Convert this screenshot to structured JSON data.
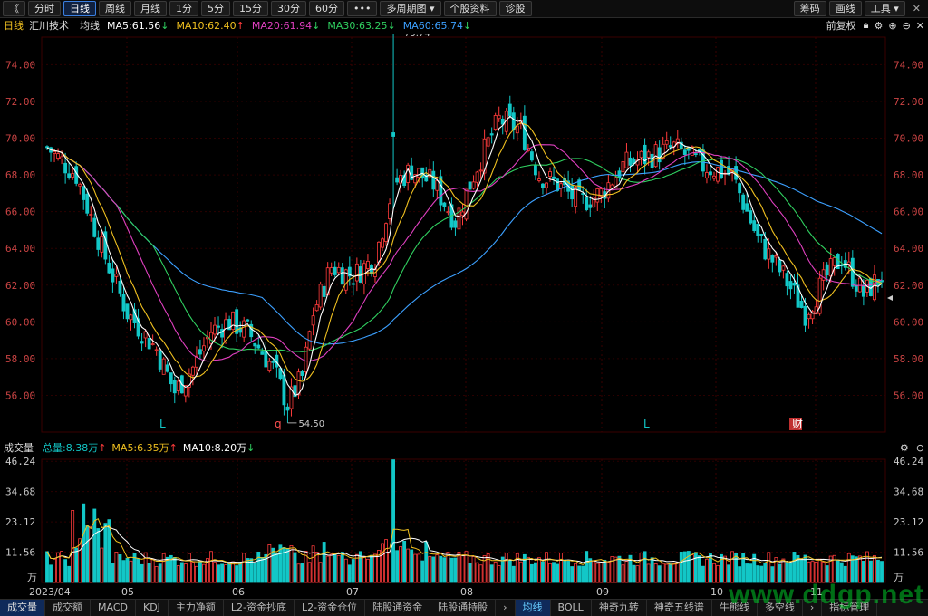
{
  "toolbar": {
    "back": "《",
    "buttons": [
      "分时",
      "日线",
      "周线",
      "月线",
      "1分",
      "5分",
      "15分",
      "30分",
      "60分",
      "•••",
      "多周期图 ▾",
      "个股资料",
      "诊股"
    ],
    "active": "日线",
    "right": [
      "筹码",
      "画线",
      "工具 ▾"
    ]
  },
  "stock": {
    "period": "日线",
    "name": "汇川技术",
    "ma_label": "均线"
  },
  "ma": [
    {
      "label": "MA5:61.56",
      "arrow": "↓",
      "color": "#ffffff"
    },
    {
      "label": "MA10:62.40",
      "arrow": "↑",
      "color": "#f0c020"
    },
    {
      "label": "MA20:61.94",
      "arrow": "↓",
      "color": "#e040c0"
    },
    {
      "label": "MA30:63.25",
      "arrow": "↓",
      "color": "#30d060"
    },
    {
      "label": "MA60:65.74",
      "arrow": "↓",
      "color": "#3ca0ff"
    }
  ],
  "adjust": "前复权",
  "vol": {
    "title": "成交量",
    "total": "总量:8.38万",
    "total_arrow": "↑",
    "ma5": "MA5:6.35万",
    "ma5_arrow": "↑",
    "ma10": "MA10:8.20万",
    "ma10_arrow": "↓"
  },
  "price_axis": {
    "min": 54.0,
    "max": 75.5,
    "ticks": [
      "74.00",
      "72.00",
      "70.00",
      "68.00",
      "66.00",
      "64.00",
      "62.00",
      "60.00",
      "58.00",
      "56.00"
    ]
  },
  "vol_axis": {
    "max": 47,
    "ticks": [
      "46.24",
      "34.68",
      "23.12",
      "11.56"
    ],
    "unit": "万"
  },
  "months": [
    "2023/04",
    "05",
    "06",
    "07",
    "08",
    "09",
    "10",
    "11"
  ],
  "annotations": {
    "high": "75.74",
    "low": "54.50",
    "markers": [
      "L",
      "q",
      "L",
      "财"
    ]
  },
  "bottom_tabs": [
    "成交量",
    "成交额",
    "MACD",
    "KDJ",
    "主力净额",
    "L2-资金抄底",
    "L2-资金仓位",
    "陆股通资金",
    "陆股通持股",
    "›",
    "均线",
    "BOLL",
    "神奇九转",
    "神奇五线谱",
    "牛熊线",
    "多空线",
    "›",
    "指标管理"
  ],
  "active_tab": "均线",
  "watermark": "www.ddgp.net",
  "colors": {
    "up": "#ff3b3b",
    "down": "#12c7c7",
    "grid": "#2b0000",
    "axis": "#cc4444"
  }
}
